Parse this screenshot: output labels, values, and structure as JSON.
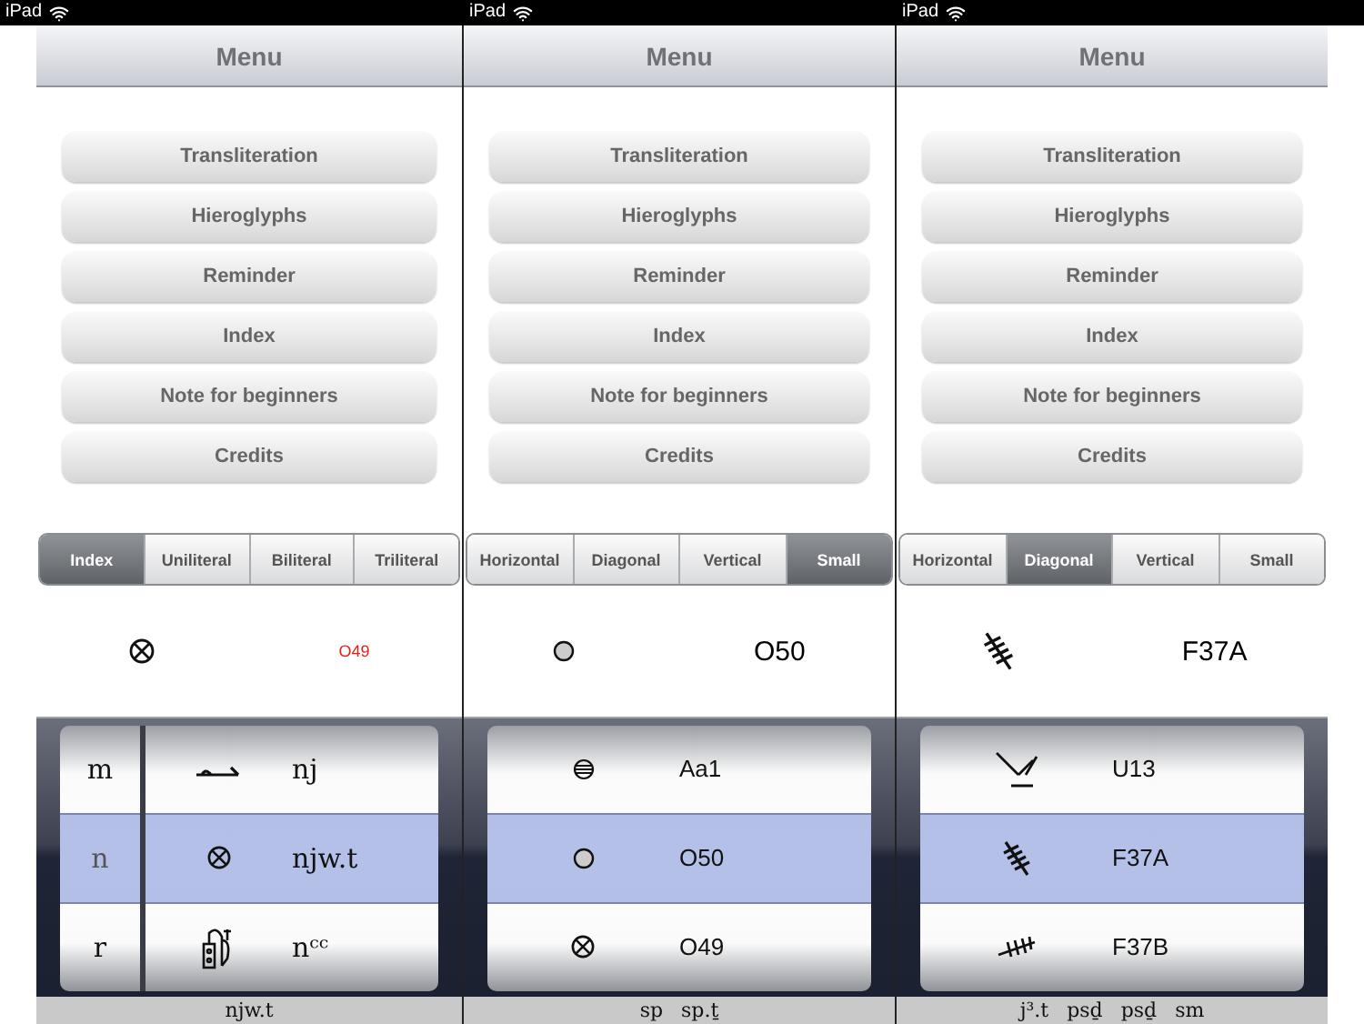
{
  "panels": [
    {
      "carrier": "iPad",
      "nav_title": "Menu",
      "menu": [
        "Transliteration",
        "Hieroglyphs",
        "Reminder",
        "Index",
        "Note for beginners",
        "Credits"
      ],
      "segments": [
        {
          "label": "Index",
          "selected": true
        },
        {
          "label": "Uniliteral",
          "selected": false
        },
        {
          "label": "Biliteral",
          "selected": false
        },
        {
          "label": "Triliteral",
          "selected": false
        }
      ],
      "preview": {
        "code": "O49",
        "color": "#e8201c"
      },
      "picker": {
        "kind": "columns",
        "rows": [
          {
            "letter": "m",
            "label": "nj",
            "selected": false
          },
          {
            "letter": "n",
            "label": "njw.t",
            "selected": true
          },
          {
            "letter": "r",
            "label": "nᶜᶜ",
            "selected": false
          }
        ]
      },
      "footer": [
        "njw.t"
      ]
    },
    {
      "carrier": "iPad",
      "nav_title": "Menu",
      "menu": [
        "Transliteration",
        "Hieroglyphs",
        "Reminder",
        "Index",
        "Note for beginners",
        "Credits"
      ],
      "segments": [
        {
          "label": "Horizontal",
          "selected": false
        },
        {
          "label": "Diagonal",
          "selected": false
        },
        {
          "label": "Vertical",
          "selected": false
        },
        {
          "label": "Small",
          "selected": true
        }
      ],
      "preview": {
        "code": "O50",
        "color": "#000000"
      },
      "picker": {
        "kind": "single",
        "rows": [
          {
            "label": "Aa1",
            "selected": false
          },
          {
            "label": "O50",
            "selected": true
          },
          {
            "label": "O49",
            "selected": false
          }
        ]
      },
      "footer": [
        "sp",
        "sp.ṯ"
      ]
    },
    {
      "carrier": "iPad",
      "nav_title": "Menu",
      "menu": [
        "Transliteration",
        "Hieroglyphs",
        "Reminder",
        "Index",
        "Note for beginners",
        "Credits"
      ],
      "segments": [
        {
          "label": "Horizontal",
          "selected": false
        },
        {
          "label": "Diagonal",
          "selected": true
        },
        {
          "label": "Vertical",
          "selected": false
        },
        {
          "label": "Small",
          "selected": false
        }
      ],
      "preview": {
        "code": "F37A",
        "color": "#000000"
      },
      "picker": {
        "kind": "single",
        "rows": [
          {
            "label": "U13",
            "selected": false
          },
          {
            "label": "F37A",
            "selected": true
          },
          {
            "label": "F37B",
            "selected": false
          }
        ]
      },
      "footer": [
        "j³.t",
        "psḏ",
        "psḏ",
        "sm"
      ]
    }
  ]
}
